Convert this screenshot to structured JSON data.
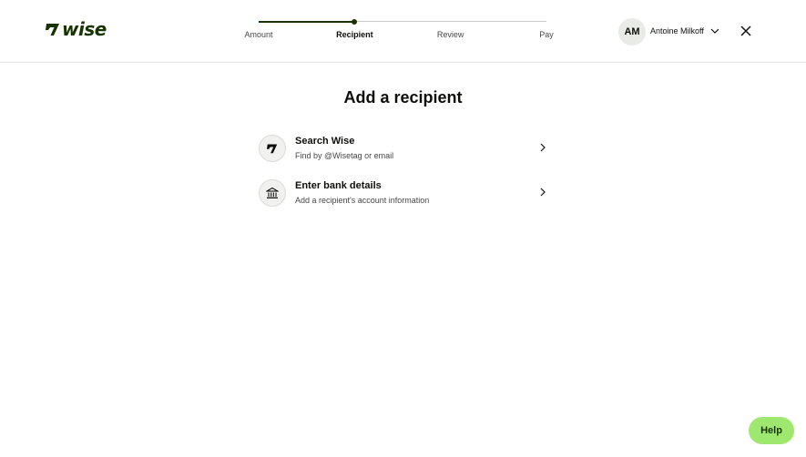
{
  "header": {
    "logo_text": "wise",
    "logo_icon": "wise-flag-icon",
    "steps": [
      {
        "label": "Amount",
        "state": "done"
      },
      {
        "label": "Recipient",
        "state": "active"
      },
      {
        "label": "Review",
        "state": "pending"
      },
      {
        "label": "Pay",
        "state": "pending"
      }
    ],
    "progress_fraction": 0.333,
    "user": {
      "initials": "AM",
      "name": "Antoine Milkoff",
      "menu_icon": "chevron-down-icon"
    },
    "close_icon": "close-icon"
  },
  "main": {
    "title": "Add a recipient",
    "options": [
      {
        "title": "Search Wise",
        "subtitle": "Find by @Wisetag or email",
        "icon": "wise-flag-icon"
      },
      {
        "title": "Enter bank details",
        "subtitle": "Add a recipient's account information",
        "icon": "bank-icon"
      }
    ]
  },
  "help": {
    "label": "Help"
  },
  "colors": {
    "brand_dark": "#163300",
    "brand_green": "#9fe870",
    "text_primary": "#0e0f0c",
    "text_secondary": "#454745"
  }
}
